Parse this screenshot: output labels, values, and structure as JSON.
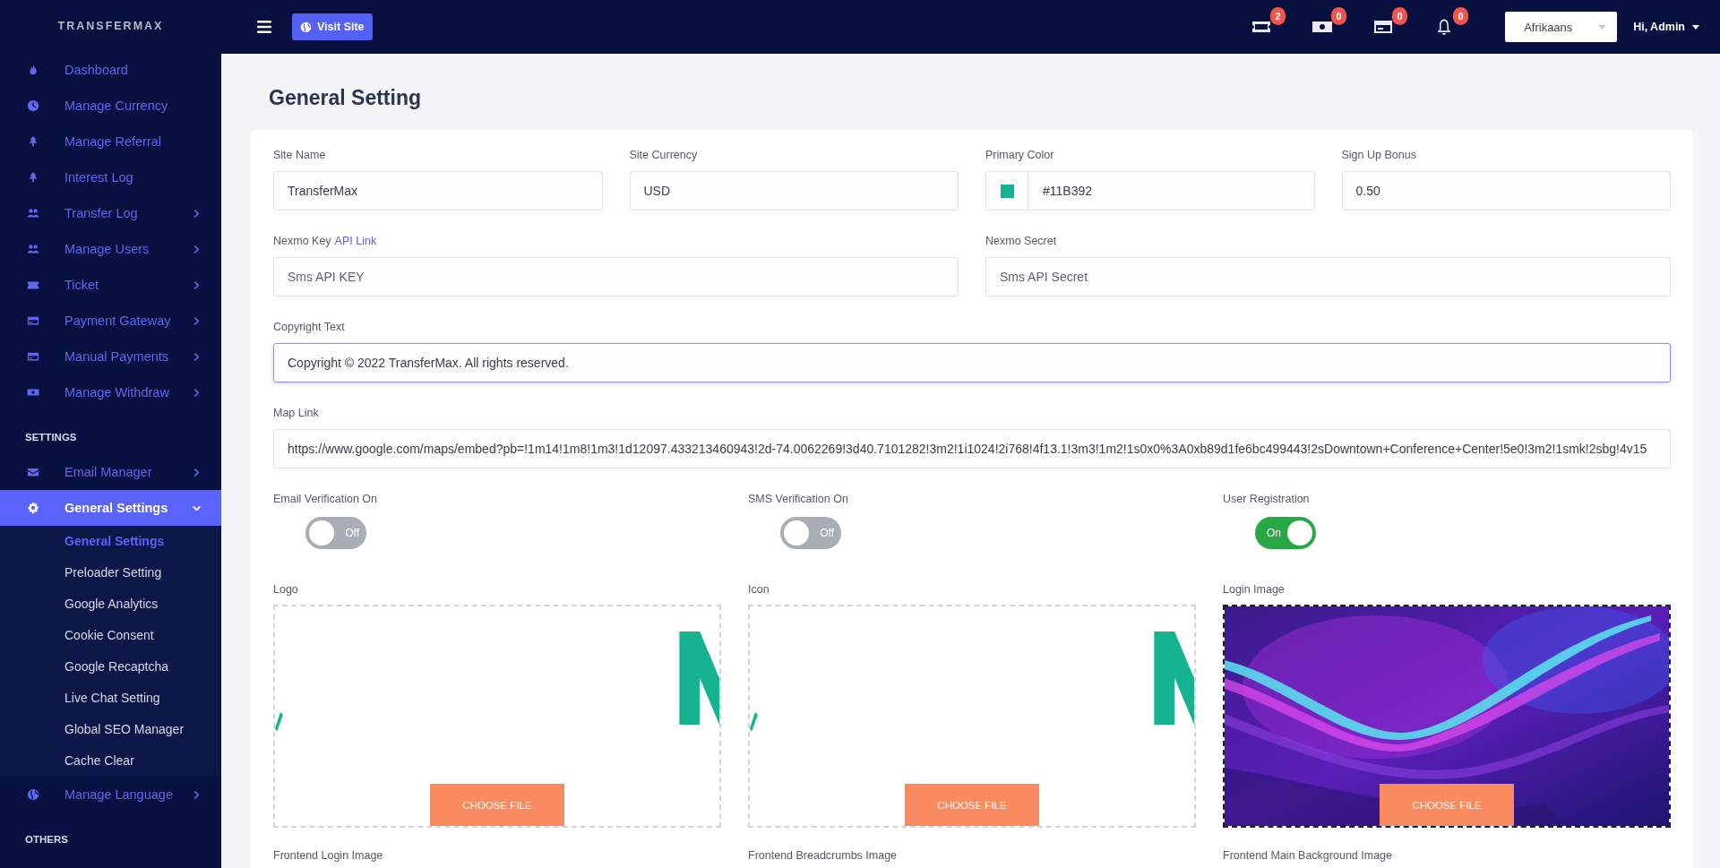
{
  "sidebar": {
    "brand": "TRANSFERMAX",
    "sections": [
      {
        "items": [
          {
            "label": "Dashboard",
            "submenu": false,
            "selected": false
          },
          {
            "label": "Manage Currency",
            "submenu": false,
            "selected": false
          },
          {
            "label": "Manage Referral",
            "submenu": false,
            "selected": false
          },
          {
            "label": "Interest Log",
            "submenu": false,
            "selected": false
          },
          {
            "label": "Transfer Log",
            "submenu": true,
            "expanded": false,
            "selected": false
          },
          {
            "label": "Manage Users",
            "submenu": true,
            "expanded": false,
            "selected": false
          },
          {
            "label": "Ticket",
            "submenu": true,
            "expanded": false,
            "selected": false
          },
          {
            "label": "Payment Gateway",
            "submenu": true,
            "expanded": false,
            "selected": false
          },
          {
            "label": "Manual Payments",
            "submenu": true,
            "expanded": false,
            "selected": false
          },
          {
            "label": "Manage Withdraw",
            "submenu": true,
            "expanded": false,
            "selected": false
          }
        ]
      },
      {
        "heading": "SETTINGS",
        "items": [
          {
            "label": "Email Manager",
            "submenu": true,
            "expanded": false,
            "selected": false
          },
          {
            "label": "General Settings",
            "submenu": true,
            "expanded": true,
            "selected": true,
            "children": [
              {
                "label": "General Settings",
                "selected": true
              },
              {
                "label": "Preloader Setting",
                "selected": false
              },
              {
                "label": "Google Analytics",
                "selected": false
              },
              {
                "label": "Cookie Consent",
                "selected": false
              },
              {
                "label": "Google Recaptcha",
                "selected": false
              },
              {
                "label": "Live Chat Setting",
                "selected": false
              },
              {
                "label": "Global SEO Manager",
                "selected": false
              },
              {
                "label": "Cache Clear",
                "selected": false
              }
            ]
          },
          {
            "label": "Manage Language",
            "submenu": true,
            "expanded": false,
            "selected": false
          }
        ]
      },
      {
        "heading": "OTHERS"
      }
    ]
  },
  "topbar": {
    "visit_button": "Visit Site",
    "badges": [
      {
        "count": "2"
      },
      {
        "count": "0"
      },
      {
        "count": "0"
      },
      {
        "count": "0"
      }
    ],
    "language": "Afrikaans",
    "user": "Hi, Admin"
  },
  "page_title": "General Setting",
  "form_rows": [
    [
      {
        "kind": "text",
        "label": "Site Name",
        "value": "TransferMax"
      },
      {
        "kind": "text",
        "label": "Site Currency",
        "value": "USD"
      },
      {
        "kind": "color",
        "label": "Primary Color",
        "value": "#11B392"
      },
      {
        "kind": "text",
        "label": "Sign Up Bonus",
        "value": "0.50"
      }
    ],
    [
      {
        "kind": "text",
        "label": "Nexmo Key",
        "label_link": "API Link",
        "placeholder": "Sms API KEY"
      },
      {
        "kind": "text",
        "label": "Nexmo Secret",
        "placeholder": "Sms API Secret"
      }
    ],
    [
      {
        "kind": "text",
        "label": "Copyright Text",
        "value": "Copyright © 2022 TransferMax. All rights reserved.",
        "focused": true
      }
    ],
    [
      {
        "kind": "text",
        "label": "Map Link",
        "value": "https://www.google.com/maps/embed?pb=!1m14!1m8!1m3!1d12097.433213460943!2d-74.0062269!3d40.7101282!3m2!1i1024!2i768!4f13.1!3m3!1m2!1s0x0%3A0xb89d1fe6bc499443!2sDowntown+Conference+Center!5e0!3m2!1smk!2sbg!4v15"
      }
    ]
  ],
  "toggles": [
    {
      "label": "Email Verification On",
      "on": false,
      "text": "Off"
    },
    {
      "label": "SMS Verification On",
      "on": false,
      "text": "Off"
    },
    {
      "label": "User Registration",
      "on": true,
      "text": "On"
    }
  ],
  "images": [
    {
      "label": "Logo",
      "kind": "logo",
      "button": "CHOOSE FILE"
    },
    {
      "label": "Icon",
      "kind": "logo",
      "button": "CHOOSE FILE"
    },
    {
      "label": "Login Image",
      "button": "CHOOSE FILE"
    }
  ],
  "more_labels": [
    "Frontend Login Image",
    "Frontend Breadcrumbs Image",
    "Frontend Main Background Image"
  ]
}
